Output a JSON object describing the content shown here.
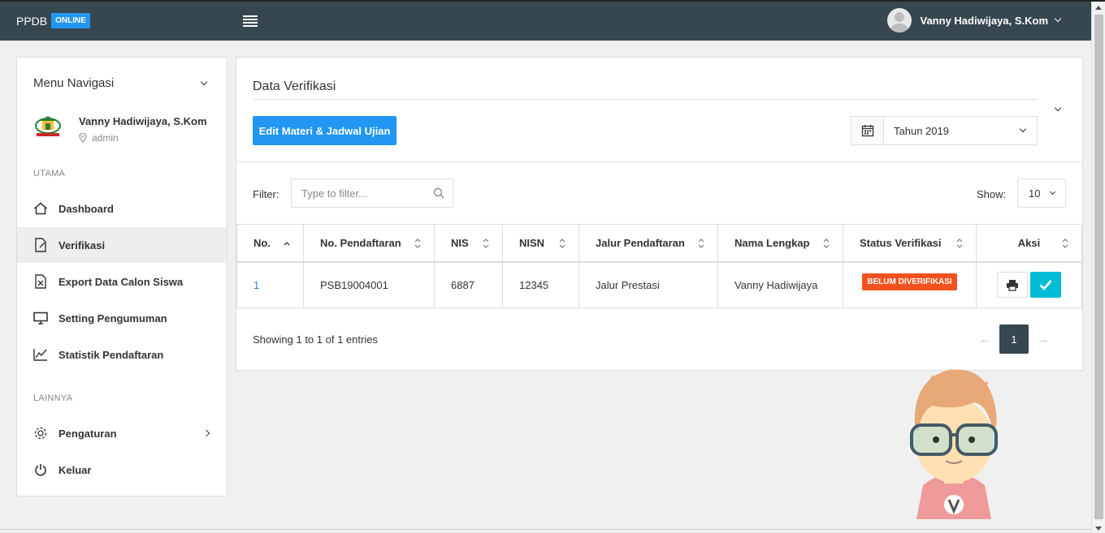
{
  "app": {
    "brand": "PPDB",
    "status_badge": "ONLINE",
    "colors": {
      "topbar": "#37474f",
      "accent": "#2196f3",
      "danger": "#f4511e",
      "info": "#00bcd4"
    }
  },
  "header": {
    "user_name": "Vanny Hadiwijaya, S.Kom"
  },
  "sidebar": {
    "title": "Menu Navigasi",
    "profile": {
      "name": "Vanny Hadiwijaya, S.Kom",
      "role": "admin"
    },
    "section_main": "UTAMA",
    "section_other": "LAINNYA",
    "items": [
      {
        "label": "Dashboard",
        "icon": "home-icon"
      },
      {
        "label": "Verifikasi",
        "icon": "document-icon",
        "active": true
      },
      {
        "label": "Export Data Calon Siswa",
        "icon": "excel-file-icon"
      },
      {
        "label": "Setting Pengumuman",
        "icon": "monitor-icon"
      },
      {
        "label": "Statistik Pendaftaran",
        "icon": "line-chart-icon"
      }
    ],
    "other_items": [
      {
        "label": "Pengaturan",
        "icon": "gear-icon"
      },
      {
        "label": "Keluar",
        "icon": "power-icon"
      }
    ]
  },
  "main": {
    "title": "Data Verifikasi",
    "edit_button": "Edit Materi & Jadwal Ujian",
    "year_select": "Tahun 2019",
    "filter_label": "Filter:",
    "filter_placeholder": "Type to filter...",
    "show_label": "Show:",
    "show_value": "10",
    "columns": [
      "No.",
      "No. Pendaftaran",
      "NIS",
      "NISN",
      "Jalur Pendaftaran",
      "Nama Lengkap",
      "Status Verifikasi",
      "Aksi"
    ],
    "rows": [
      {
        "no": "1",
        "no_pendaftaran": "PSB19004001",
        "nis": "6887",
        "nisn": "12345",
        "jalur": "Jalur Prestasi",
        "nama": "Vanny Hadiwijaya",
        "status": "BELUM DIVERIFIKASI"
      }
    ],
    "showing": "Showing 1 to 1 of 1 entries",
    "pagination": {
      "prev": "←",
      "current": "1",
      "next": "→"
    }
  }
}
